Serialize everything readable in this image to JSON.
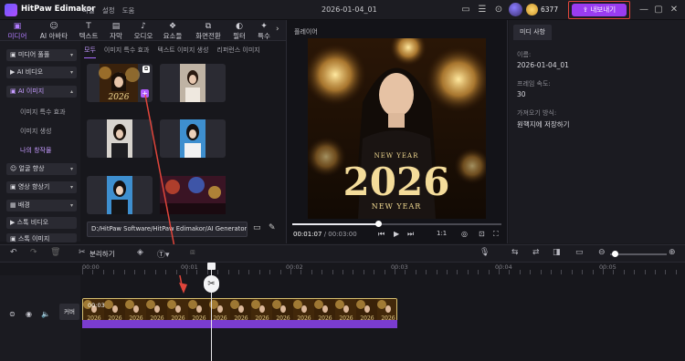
{
  "app": {
    "name": "HitPaw Edimakor",
    "menu": [
      "파일",
      "설정",
      "도움"
    ],
    "window_title": "2026-01-04_01",
    "credits": "6377",
    "export_label": "내보내기"
  },
  "toolbar": [
    {
      "label": "미디어",
      "icon": "media-icon"
    },
    {
      "label": "AI 아바타",
      "icon": "ai-avatar-icon"
    },
    {
      "label": "텍스트",
      "icon": "text-icon"
    },
    {
      "label": "자막",
      "icon": "subtitle-icon"
    },
    {
      "label": "오디오",
      "icon": "audio-icon"
    },
    {
      "label": "요소들",
      "icon": "elements-icon"
    },
    {
      "label": "화면전환",
      "icon": "transition-icon"
    },
    {
      "label": "필터",
      "icon": "filter-icon"
    },
    {
      "label": "특수",
      "icon": "effects-icon"
    }
  ],
  "media_tabs": [
    "모두",
    "이미지 특수 효과",
    "텍스트 이미지 생성",
    "리퍼런스 이미지"
  ],
  "sidebar": {
    "items": [
      "미디어 풀풀",
      "AI 비디오",
      "AI 이미지",
      "얼굴 향상",
      "영상 향상기",
      "배경",
      "스톡 비디오",
      "스톡 이미지"
    ],
    "subitems": [
      "이미지 특수 효과",
      "이미지 생성",
      "나의 창작물"
    ]
  },
  "path": "D:/HitPaw Software/HitPaw Edimakor/AI Generator",
  "preview": {
    "label": "플레이어",
    "current": "00:01:07",
    "total": "/ 00:03:00",
    "ratio": "1:1",
    "overlay_top": "NEW YEAR",
    "overlay_year": "2026",
    "overlay_bottom": "NEW YEAR"
  },
  "properties": {
    "tab": "미디 사항",
    "name_label": "이름:",
    "name_value": "2026-01-04_01",
    "fps_label": "프레임 속도:",
    "fps_value": "30",
    "layout_label": "가져오기 방식:",
    "layout_value": "원핵지에 저장하기"
  },
  "timeline": {
    "split_label": "분리하기",
    "ruler": [
      "00:00",
      "00:01",
      "00:02",
      "00:03",
      "00:04",
      "00:05"
    ],
    "clip_label": "00:03",
    "cover_label": "커버"
  },
  "colors": {
    "accent": "#9a3cf0",
    "highlight": "#e0453b"
  }
}
